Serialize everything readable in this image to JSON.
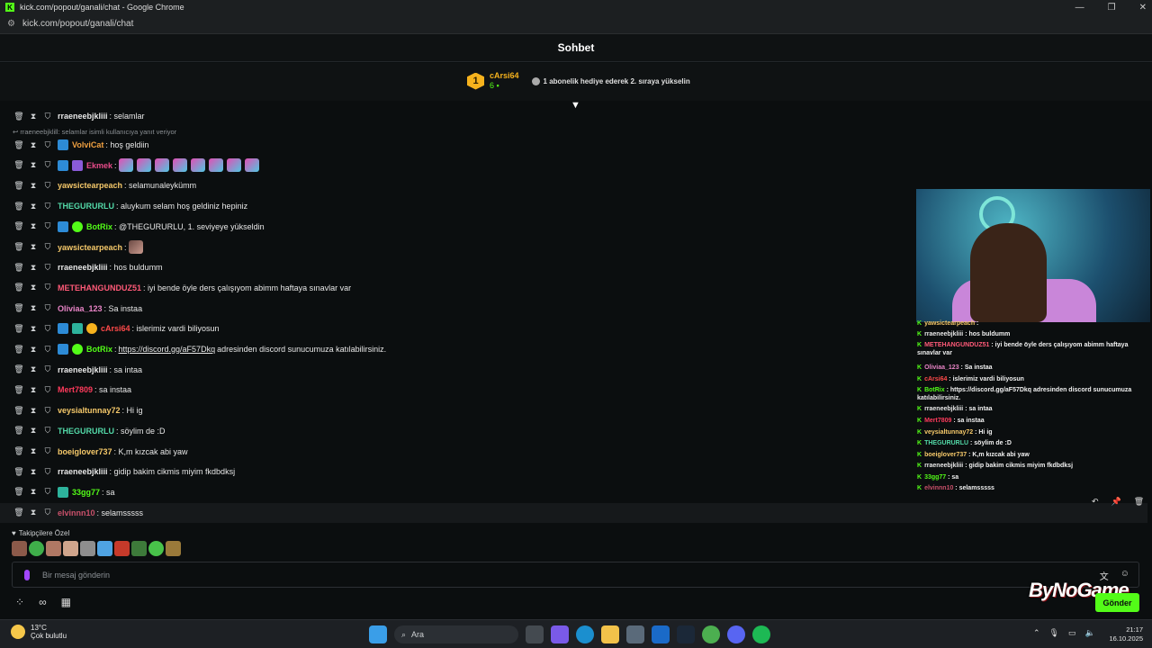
{
  "window": {
    "title": "kick.com/popout/ganali/chat - Google Chrome",
    "url": "kick.com/popout/ganali/chat"
  },
  "chat": {
    "header": "Sohbet",
    "leader": {
      "rank": "1",
      "name": "cArsi64",
      "count": "6",
      "info": "1 abonelik hediye ederek 2. sıraya yükselin"
    },
    "reply_notice": "rraeneebjklill: selamlar isimli kullanıcıya yanıt veriyor",
    "messages": [
      {
        "user": "rraeneebjkliii",
        "color": "#e8e8e8",
        "text": ": selamlar"
      },
      {
        "user": "VolviCat",
        "color": "#f0a040",
        "text": ": hoş geldiin"
      },
      {
        "user": "Ekmek",
        "color": "#e84b8a",
        "text": ":"
      },
      {
        "user": "yawsictearpeach",
        "color": "#f6c96a",
        "text": ": selamunaleykümm"
      },
      {
        "user": "THEGURURLU",
        "color": "#53d9a8",
        "text": ": aluykum selam hoş geldiniz hepiniz"
      },
      {
        "user": "BotRix",
        "color": "#53fc18",
        "text": ": @THEGURURLU, 1. seviyeye yükseldin"
      },
      {
        "user": "yawsictearpeach",
        "color": "#f6c96a",
        "text": ":"
      },
      {
        "user": "rraeneebjkliii",
        "color": "#e8e8e8",
        "text": ": hos buldumm"
      },
      {
        "user": "METEHANGUNDUZ51",
        "color": "#ff5a78",
        "text": ": iyi bende öyle ders çalışıyom abimm haftaya sınavlar var"
      },
      {
        "user": "Oliviaa_123",
        "color": "#e884c6",
        "text": ": Sa instaa"
      },
      {
        "user": "cArsi64",
        "color": "#ff4a4a",
        "text": ": islerimiz vardi biliyosun"
      },
      {
        "user": "BotRix",
        "color": "#53fc18",
        "text": ": ",
        "link": "https://discord.gg/aF57Dkq",
        "tail": " adresinden discord sunucumuza katılabilirsiniz."
      },
      {
        "user": "rraeneebjkliii",
        "color": "#e8e8e8",
        "text": ": sa intaa"
      },
      {
        "user": "Mert7809",
        "color": "#ff3b5c",
        "text": ": sa instaa"
      },
      {
        "user": "veysialtunnay72",
        "color": "#f6c96a",
        "text": ": Hi ig"
      },
      {
        "user": "THEGURURLU",
        "color": "#53d9a8",
        "text": ": söylim de :D"
      },
      {
        "user": "boeiglover737",
        "color": "#f6c96a",
        "text": ": K,m kızcak abi yaw"
      },
      {
        "user": "rraeneebjkliii",
        "color": "#e8e8e8",
        "text": ": gidip bakim cikmis miyim fkdbdksj"
      },
      {
        "user": "33gg77",
        "color": "#53fc18",
        "text": ": sa"
      },
      {
        "user": "elvinnn10",
        "color": "#c8506a",
        "text": ": selamsssss"
      }
    ],
    "followers_label": "Takipçilere Özel",
    "input_placeholder": "Bir mesaj gönderin",
    "send_label": "Gönder"
  },
  "overlay": {
    "lines": [
      {
        "user": "yawsictearpeach",
        "color": "#f6c96a",
        "text": " :"
      },
      {
        "user": "rraeneebjkliii",
        "color": "#e8e8e8",
        "text": " : hos buldumm"
      },
      {
        "user": "METEHANGUNDUZ51",
        "color": "#ff5a78",
        "text": " : iyi bende öyle ders çalışıyom abimm haftaya sınavlar var"
      },
      {
        "user": "Oliviaa_123",
        "color": "#e884c6",
        "text": " : Sa instaa"
      },
      {
        "user": "cArsi64",
        "color": "#ff4a4a",
        "text": " : islerimiz vardi biliyosun"
      },
      {
        "user": "BotRix",
        "color": "#53fc18",
        "text": " : https://discord.gg/aF57Dkq adresinden discord sunucumuza katılabilirsiniz."
      },
      {
        "user": "rraeneebjkliii",
        "color": "#e8e8e8",
        "text": " : sa intaa"
      },
      {
        "user": "Mert7809",
        "color": "#ff3b5c",
        "text": " : sa instaa"
      },
      {
        "user": "veysialtunnay72",
        "color": "#f6c96a",
        "text": " : Hi ig"
      },
      {
        "user": "THEGURURLU",
        "color": "#53d9a8",
        "text": " : söylim de :D"
      },
      {
        "user": "boeiglover737",
        "color": "#f6c96a",
        "text": " : K,m kızcak abi yaw"
      },
      {
        "user": "rraeneebjkliii",
        "color": "#e8e8e8",
        "text": " : gidip bakim cikmis miyim fkdbdksj"
      },
      {
        "user": "33gg77",
        "color": "#53fc18",
        "text": " : sa"
      },
      {
        "user": "elvinnn10",
        "color": "#c8506a",
        "text": " : selamsssss"
      }
    ],
    "brand": "ByNoGame"
  },
  "taskbar": {
    "temp": "13°C",
    "weather": "Çok bulutlu",
    "search": "Ara",
    "time": "21:17",
    "date": "16.10.2025"
  },
  "colors": {
    "accent": "#53fc18",
    "gold": "#f6b21d"
  }
}
